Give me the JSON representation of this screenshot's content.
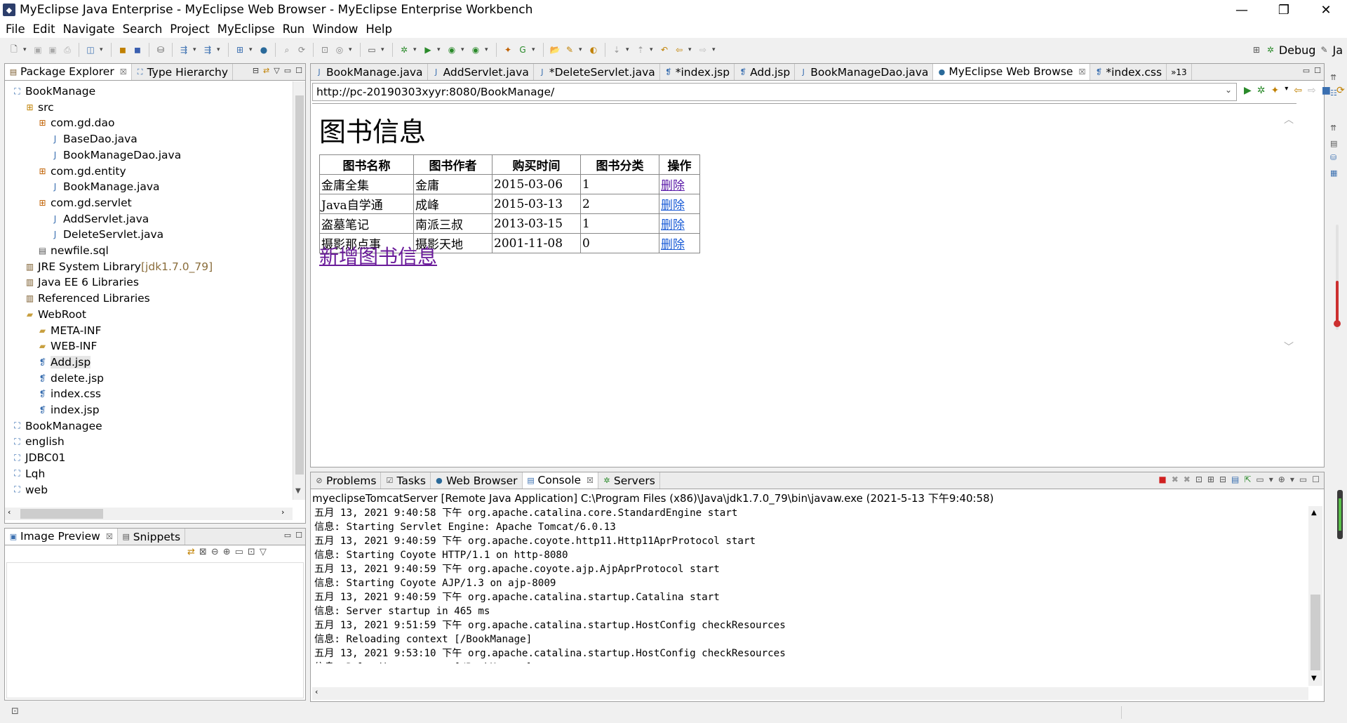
{
  "window": {
    "title": "MyEclipse Java Enterprise - MyEclipse Web Browser - MyEclipse Enterprise Workbench"
  },
  "menu": [
    "File",
    "Edit",
    "Navigate",
    "Search",
    "Project",
    "MyEclipse",
    "Run",
    "Window",
    "Help"
  ],
  "perspective": {
    "label": "Debug",
    "extra": "Ja"
  },
  "explorer": {
    "tabs": [
      {
        "label": "Package Explorer"
      },
      {
        "label": "Type Hierarchy"
      }
    ],
    "tree": [
      {
        "label": "BookManage",
        "icon": "project-icon",
        "depth": 0
      },
      {
        "label": "src",
        "icon": "source-folder-icon",
        "depth": 1
      },
      {
        "label": "com.gd.dao",
        "icon": "package-icon",
        "depth": 2
      },
      {
        "label": "BaseDao.java",
        "icon": "java-file-icon",
        "depth": 3
      },
      {
        "label": "BookManageDao.java",
        "icon": "java-file-icon",
        "depth": 3
      },
      {
        "label": "com.gd.entity",
        "icon": "package-icon",
        "depth": 2
      },
      {
        "label": "BookManage.java",
        "icon": "java-file-icon",
        "depth": 3
      },
      {
        "label": "com.gd.servlet",
        "icon": "package-icon",
        "depth": 2
      },
      {
        "label": "AddServlet.java",
        "icon": "java-file-icon",
        "depth": 3
      },
      {
        "label": "DeleteServlet.java",
        "icon": "java-file-icon",
        "depth": 3
      },
      {
        "label": "newfile.sql",
        "icon": "sql-file-icon",
        "depth": 2
      },
      {
        "label": "JRE System Library",
        "extra": "[jdk1.7.0_79]",
        "icon": "library-icon",
        "depth": 1
      },
      {
        "label": "Java EE 6 Libraries",
        "icon": "library-icon",
        "depth": 1
      },
      {
        "label": "Referenced Libraries",
        "icon": "library-icon",
        "depth": 1
      },
      {
        "label": "WebRoot",
        "icon": "folder-open-icon",
        "depth": 1
      },
      {
        "label": "META-INF",
        "icon": "folder-icon",
        "depth": 2
      },
      {
        "label": "WEB-INF",
        "icon": "folder-icon",
        "depth": 2
      },
      {
        "label": "Add.jsp",
        "icon": "jsp-file-icon",
        "depth": 2,
        "selected": true
      },
      {
        "label": "delete.jsp",
        "icon": "jsp-file-icon",
        "depth": 2
      },
      {
        "label": "index.css",
        "icon": "css-file-icon",
        "depth": 2
      },
      {
        "label": "index.jsp",
        "icon": "jsp-file-icon",
        "depth": 2
      },
      {
        "label": "BookManagee",
        "icon": "project-icon",
        "depth": 0
      },
      {
        "label": "english",
        "icon": "project-icon",
        "depth": 0
      },
      {
        "label": "JDBC01",
        "icon": "project-icon",
        "depth": 0
      },
      {
        "label": "Lqh",
        "icon": "project-icon",
        "depth": 0
      },
      {
        "label": "web",
        "icon": "project-icon",
        "depth": 0
      }
    ]
  },
  "preview": {
    "tabs": [
      {
        "label": "Image Preview"
      },
      {
        "label": "Snippets"
      }
    ]
  },
  "editor": {
    "tabs": [
      {
        "label": "BookManage.java",
        "icon": "java-file-icon"
      },
      {
        "label": "AddServlet.java",
        "icon": "java-file-icon"
      },
      {
        "label": "*DeleteServlet.java",
        "icon": "java-file-icon"
      },
      {
        "label": "*index.jsp",
        "icon": "jsp-file-icon"
      },
      {
        "label": "Add.jsp",
        "icon": "jsp-file-icon"
      },
      {
        "label": "BookManageDao.java",
        "icon": "java-file-icon"
      },
      {
        "label": "MyEclipse Web Browse",
        "icon": "globe-icon",
        "active": true
      },
      {
        "label": "*index.css",
        "icon": "css-file-icon"
      }
    ],
    "overflow": "»13",
    "url": "http://pc-20190303xyyr:8080/BookManage/"
  },
  "page": {
    "heading": "图书信息",
    "columns": [
      "图书名称",
      "图书作者",
      "购买时间",
      "图书分类",
      "操作"
    ],
    "rows": [
      [
        "金庸全集",
        "金庸",
        "2015-03-06",
        "1",
        "删除"
      ],
      [
        "Java自学通",
        "成峰",
        "2015-03-13",
        "2",
        "删除"
      ],
      [
        "盗墓笔记",
        "南派三叔",
        "2013-03-15",
        "1",
        "删除"
      ],
      [
        "摄影那点事",
        "摄影天地",
        "2001-11-08",
        "0",
        "删除"
      ]
    ],
    "add_link": "新增图书信息"
  },
  "bottom": {
    "tabs": [
      {
        "label": "Problems",
        "icon": "problems-icon"
      },
      {
        "label": "Tasks",
        "icon": "tasks-icon"
      },
      {
        "label": "Web Browser",
        "icon": "globe-icon"
      },
      {
        "label": "Console",
        "icon": "console-icon",
        "active": true
      },
      {
        "label": "Servers",
        "icon": "servers-icon"
      }
    ],
    "header": "myeclipseTomcatServer [Remote Java Application] C:\\Program Files (x86)\\Java\\jdk1.7.0_79\\bin\\javaw.exe (2021-5-13 下午9:40:58)",
    "lines": [
      "五月 13, 2021 9:40:58 下午 org.apache.catalina.core.StandardEngine start",
      "信息: Starting Servlet Engine: Apache Tomcat/6.0.13",
      "五月 13, 2021 9:40:59 下午 org.apache.coyote.http11.Http11AprProtocol start",
      "信息: Starting Coyote HTTP/1.1 on http-8080",
      "五月 13, 2021 9:40:59 下午 org.apache.coyote.ajp.AjpAprProtocol start",
      "信息: Starting Coyote AJP/1.3 on ajp-8009",
      "五月 13, 2021 9:40:59 下午 org.apache.catalina.startup.Catalina start",
      "信息: Server startup in 465 ms",
      "五月 13, 2021 9:51:59 下午 org.apache.catalina.startup.HostConfig checkResources",
      "信息: Reloading context [/BookManage]",
      "五月 13, 2021 9:53:10 下午 org.apache.catalina.startup.HostConfig checkResources",
      "信息: Reloading context [/BookManage]"
    ]
  }
}
